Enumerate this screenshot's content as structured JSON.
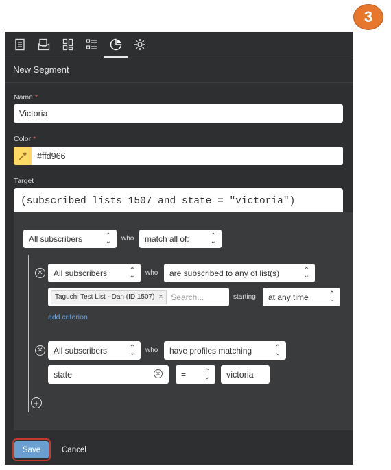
{
  "step_number": "3",
  "toolbar": {
    "icons": [
      "document-icon",
      "mail-icon",
      "layout-icon",
      "list-icon",
      "segment-icon",
      "gear-icon"
    ],
    "active": "segment-icon"
  },
  "page_title": "New Segment",
  "form": {
    "name_label": "Name",
    "name_value": "Victoria",
    "color_label": "Color",
    "color_value": "#ffd966",
    "target_label": "Target",
    "target_expression": "(subscribed lists 1507 and state = \"victoria\")",
    "required_mark": "*"
  },
  "builder": {
    "top": {
      "subscribers": "All subscribers",
      "who": "who",
      "match": "match all of:"
    },
    "criterion1": {
      "subscribers": "All subscribers",
      "who": "who",
      "condition": "are subscribed to any of list(s)",
      "tag": "Taguchi Test List - Dan (ID 1507)",
      "tag_remove": "×",
      "search_placeholder": "Search...",
      "starting_label": "starting",
      "starting_value": "at any time"
    },
    "add_criterion": "add criterion",
    "criterion2": {
      "subscribers": "All subscribers",
      "who": "who",
      "condition": "have profiles matching",
      "field": "state",
      "operator": "=",
      "value": "victoria"
    }
  },
  "footer": {
    "save": "Save",
    "cancel": "Cancel"
  },
  "colors": {
    "accent": "#6a9fd0",
    "badge": "#e8772e",
    "panel": "#2e2f31"
  }
}
